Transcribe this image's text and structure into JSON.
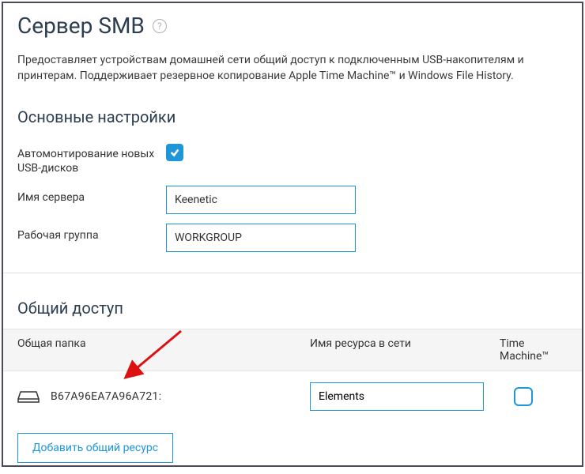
{
  "header": {
    "title": "Сервер SMB"
  },
  "description": "Предоставляет устройствам домашней сети общий доступ к подключенным USB-накопителям и принтерам. Поддерживает резервное копирование Apple Time Machine™ и Windows File History.",
  "sections": {
    "basic": {
      "title": "Основные настройки",
      "automount_label": "Автомонтирование новых USB-дисков",
      "automount_checked": true,
      "server_name_label": "Имя сервера",
      "server_name_value": "Keenetic",
      "workgroup_label": "Рабочая группа",
      "workgroup_value": "WORKGROUP"
    },
    "sharing": {
      "title": "Общий доступ",
      "columns": {
        "folder": "Общая папка",
        "resource": "Имя ресурса в сети",
        "tm": "Time Machine™"
      },
      "rows": [
        {
          "drive_id": "B67A96EA7A96A721:",
          "resource_name": "Elements",
          "tm_checked": false
        }
      ],
      "add_button": "Добавить общий ресурс"
    }
  }
}
